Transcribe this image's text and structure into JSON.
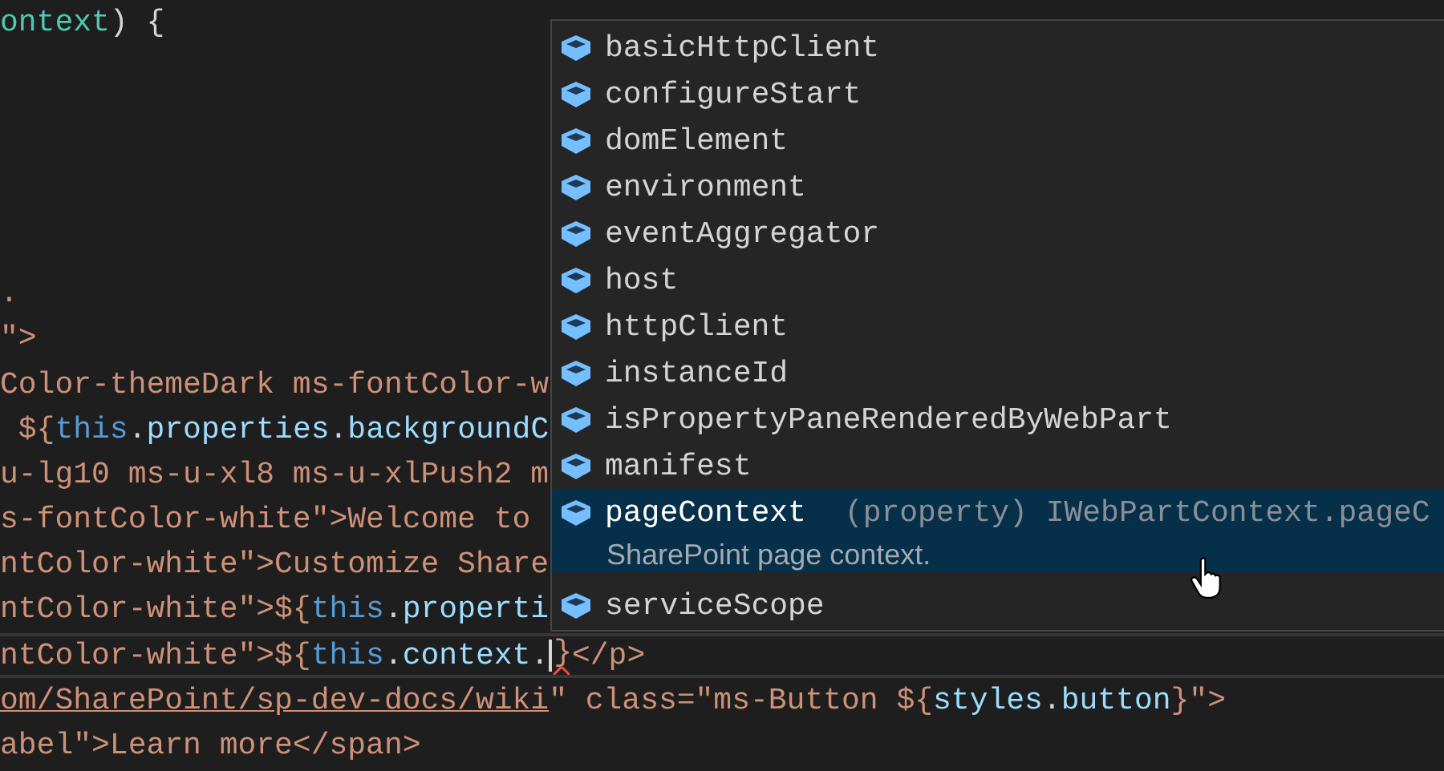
{
  "code_lines": [
    {
      "current": false,
      "tokens": [
        {
          "text": "ontext",
          "kind": "type"
        },
        {
          "text": ") {",
          "kind": "punct"
        }
      ]
    },
    {
      "current": false
    },
    {
      "current": false
    },
    {
      "current": false
    },
    {
      "current": false
    },
    {
      "current": false
    },
    {
      "current": false,
      "tokens": [
        {
          "text": ".",
          "kind": "string"
        }
      ]
    },
    {
      "current": false,
      "tokens": [
        {
          "text": "\">",
          "kind": "string"
        }
      ]
    },
    {
      "current": false,
      "tokens": [
        {
          "text": "Color-themeDark ms-fontColor-w",
          "kind": "string"
        }
      ]
    },
    {
      "current": false,
      "tokens": [
        {
          "text": " ${",
          "kind": "string"
        },
        {
          "text": "this",
          "kind": "keyword"
        },
        {
          "text": ".",
          "kind": "punct"
        },
        {
          "text": "properties",
          "kind": "property"
        },
        {
          "text": ".",
          "kind": "punct"
        },
        {
          "text": "backgroundC",
          "kind": "property"
        }
      ]
    },
    {
      "current": false,
      "tokens": [
        {
          "text": "u-lg10 ms-u-xl8 ms-u-xlPush2 m",
          "kind": "string"
        }
      ]
    },
    {
      "current": false,
      "tokens": [
        {
          "text": "s-fontColor-white\">Welcome to",
          "kind": "string"
        }
      ]
    },
    {
      "current": false,
      "tokens": [
        {
          "text": "ntColor-white\">Customize Share",
          "kind": "string"
        }
      ]
    },
    {
      "current": false,
      "tokens": [
        {
          "text": "ntColor-white\">${",
          "kind": "string"
        },
        {
          "text": "this",
          "kind": "keyword"
        },
        {
          "text": ".",
          "kind": "punct"
        },
        {
          "text": "properti",
          "kind": "property"
        }
      ]
    },
    {
      "current": true,
      "tokens": [
        {
          "text": "ntColor-white\">${",
          "kind": "string"
        },
        {
          "text": "this",
          "kind": "keyword"
        },
        {
          "text": ".",
          "kind": "punct"
        },
        {
          "text": "context",
          "kind": "property"
        },
        {
          "text": ".",
          "kind": "punct"
        },
        {
          "kind": "cursor"
        },
        {
          "text": "}",
          "kind": "string",
          "error": true
        },
        {
          "text": "</p>",
          "kind": "string"
        }
      ]
    },
    {
      "current": false,
      "tokens": [
        {
          "text": "om/SharePoint/sp-dev-docs/wiki",
          "kind": "link"
        },
        {
          "text": "\" class=\"ms-Button ${",
          "kind": "string"
        },
        {
          "text": "styles",
          "kind": "property"
        },
        {
          "text": ".",
          "kind": "punct"
        },
        {
          "text": "button",
          "kind": "property"
        },
        {
          "text": "}\">",
          "kind": "string"
        }
      ]
    },
    {
      "current": false,
      "tokens": [
        {
          "text": "abel\">Learn more</span>",
          "kind": "string"
        }
      ]
    }
  ],
  "suggestions": [
    {
      "label": "basicHttpClient",
      "selected": false
    },
    {
      "label": "configureStart",
      "selected": false
    },
    {
      "label": "domElement",
      "selected": false
    },
    {
      "label": "environment",
      "selected": false
    },
    {
      "label": "eventAggregator",
      "selected": false
    },
    {
      "label": "host",
      "selected": false
    },
    {
      "label": "httpClient",
      "selected": false
    },
    {
      "label": "instanceId",
      "selected": false
    },
    {
      "label": "isPropertyPaneRenderedByWebPart",
      "selected": false
    },
    {
      "label": "manifest",
      "selected": false
    },
    {
      "label": "pageContext",
      "selected": true,
      "detail": "(property) IWebPartContext.pageC",
      "documentation": "SharePoint page context."
    },
    {
      "label": "serviceScope",
      "selected": false
    }
  ]
}
